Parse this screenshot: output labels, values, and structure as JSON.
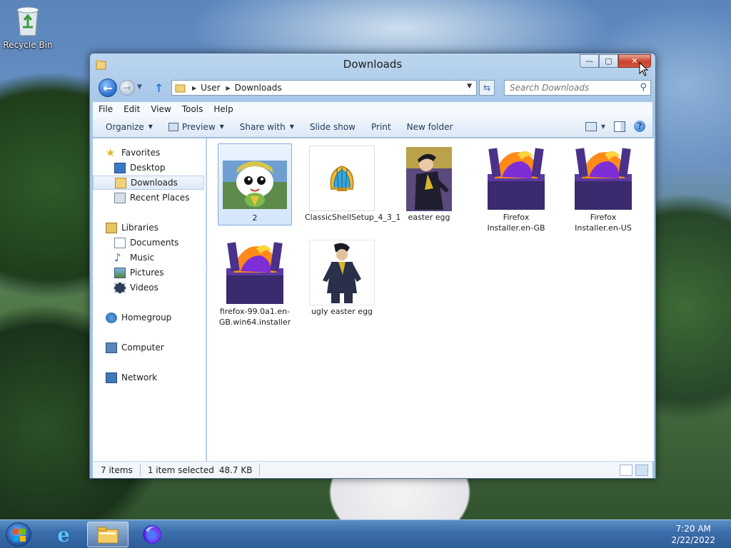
{
  "desktop": {
    "icons": [
      {
        "label": "Recycle Bin",
        "icon": "recycle-bin-icon"
      }
    ]
  },
  "window": {
    "title": "Downloads",
    "buttons": {
      "minimize": "—",
      "maximize": "▢",
      "close": "✕"
    },
    "address": {
      "crumbs": [
        "User",
        "Downloads"
      ]
    },
    "search": {
      "placeholder": "Search Downloads"
    },
    "menu": [
      "File",
      "Edit",
      "View",
      "Tools",
      "Help"
    ],
    "commands": [
      {
        "label": "Organize",
        "dropdown": true
      },
      {
        "label": "Preview",
        "dropdown": true,
        "icon": "preview-icon"
      },
      {
        "label": "Share with",
        "dropdown": true
      },
      {
        "label": "Slide show",
        "dropdown": false
      },
      {
        "label": "Print",
        "dropdown": false
      },
      {
        "label": "New folder",
        "dropdown": false
      }
    ],
    "nav_pane": {
      "favorites": {
        "label": "Favorites",
        "items": [
          "Desktop",
          "Downloads",
          "Recent Places"
        ]
      },
      "libraries": {
        "label": "Libraries",
        "items": [
          "Documents",
          "Music",
          "Pictures",
          "Videos"
        ]
      },
      "homegroup": "Homegroup",
      "computer": "Computer",
      "network": "Network"
    },
    "files": [
      {
        "name": "2",
        "thumb": "cartoon-frog-thumbnail",
        "selected": true
      },
      {
        "name": "ClassicShellSetup_4_3_1",
        "thumb": "classic-shell-icon",
        "selected": false
      },
      {
        "name": "easter egg",
        "thumb": "anime-character-thumbnail",
        "selected": false
      },
      {
        "name": "Firefox Installer.en-GB",
        "thumb": "firefox-installer-icon",
        "selected": false
      },
      {
        "name": "Firefox Installer.en-US",
        "thumb": "firefox-installer-icon",
        "selected": false
      },
      {
        "name": "firefox-99.0a1.en-GB.win64.installer",
        "thumb": "firefox-installer-icon",
        "selected": false
      },
      {
        "name": "ugly easter egg",
        "thumb": "anime-figure-thumbnail",
        "selected": false
      }
    ],
    "status": {
      "count": "7 items",
      "selection": "1 item selected",
      "size": "48.7 KB"
    }
  },
  "taskbar": {
    "apps": [
      "internet-explorer-icon",
      "file-explorer-icon",
      "firefox-icon"
    ],
    "clock": {
      "time": "7:20 AM",
      "date": "2/22/2022"
    }
  }
}
